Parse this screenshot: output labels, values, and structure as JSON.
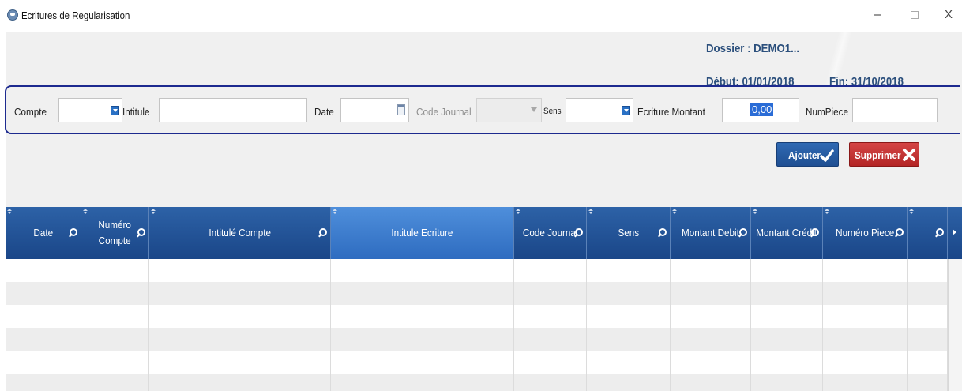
{
  "window": {
    "title": "Ecritures de Regularisation",
    "controls": {
      "minimize": "–",
      "close": "X"
    }
  },
  "info": {
    "dossier": "Dossier : DEMO1...",
    "debut": "Début: 01/01/2018",
    "fin": "Fin: 31/10/2018"
  },
  "filters": {
    "compte_label": "Compte",
    "compte_value": "",
    "intitule_label": "Intitule",
    "intitule_value": "",
    "date_label": "Date",
    "date_value": "",
    "code_journal_label": "Code Journal",
    "code_journal_value": "",
    "sens_label": "Sens",
    "sens_value": "",
    "ecriture_montant_label": "Ecriture Montant",
    "ecriture_montant_value": "0,00",
    "numpiece_label": "NumPiece",
    "numpiece_value": ""
  },
  "actions": {
    "ajouter": "Ajouter",
    "supprimer": "Supprimer"
  },
  "grid": {
    "columns": [
      {
        "label": "Date",
        "width": 96,
        "filter": true
      },
      {
        "label": "Numéro\nCompte",
        "width": 86,
        "filter": true
      },
      {
        "label": "Intitulé Compte",
        "width": 230,
        "filter": true
      },
      {
        "label": "Intitule Ecriture",
        "width": 232,
        "filter": false,
        "selected": true
      },
      {
        "label": "Code Journal",
        "width": 92,
        "filter": true
      },
      {
        "label": "Sens",
        "width": 106,
        "filter": true
      },
      {
        "label": "Montant Debit",
        "width": 102,
        "filter": true
      },
      {
        "label": "Montant Crédit",
        "width": 91,
        "filter": true
      },
      {
        "label": "Numéro Piece",
        "width": 107,
        "filter": true
      },
      {
        "label": "",
        "width": 51,
        "filter": true
      }
    ],
    "empty_rows": 6
  }
}
